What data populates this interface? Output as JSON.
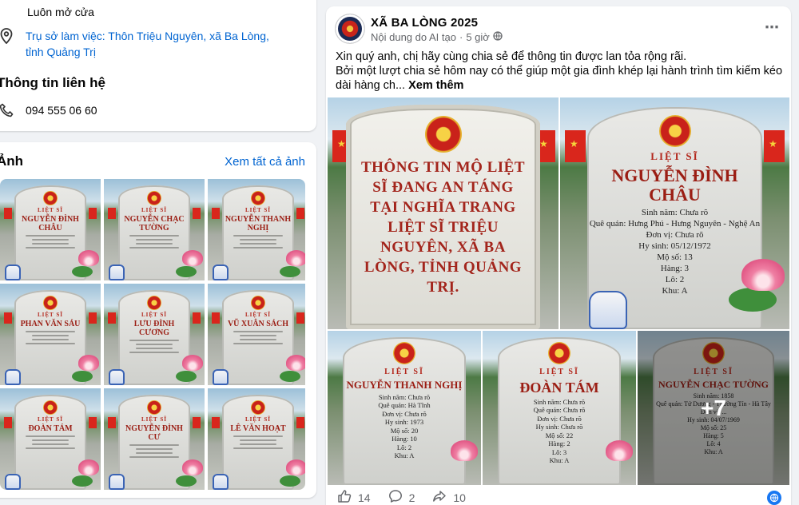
{
  "intro": {
    "hours": "Luôn mở cửa",
    "address": "Trụ sở làm việc: Thôn Triệu Nguyên, xã Ba Lòng, tỉnh Quảng Trị",
    "contact_title": "Thông tin liên hệ",
    "phone": "094 555 06 60"
  },
  "photos": {
    "title": "Ảnh",
    "see_all": "Xem tất cả ảnh",
    "tiles": [
      {
        "label": "LIỆT SĨ",
        "name": "NGUYỄN ĐÌNH CHÂU"
      },
      {
        "label": "LIỆT SĨ",
        "name": "NGUYỄN CHẠC TƯỜNG"
      },
      {
        "label": "LIỆT SĨ",
        "name": "NGUYỄN THANH NGHỊ"
      },
      {
        "label": "LIỆT SĨ",
        "name": "PHAN VĂN SÁU"
      },
      {
        "label": "LIỆT SĨ",
        "name": "LƯU ĐÌNH CƯƠNG"
      },
      {
        "label": "LIỆT SĨ",
        "name": "VŨ XUÂN SÁCH"
      },
      {
        "label": "LIỆT SĨ",
        "name": "ĐOÀN TÁM"
      },
      {
        "label": "LIỆT SĨ",
        "name": "NGUYỄN ĐÌNH CƯ"
      },
      {
        "label": "LIỆT SĨ",
        "name": "LÊ VĂN HOẠT"
      }
    ]
  },
  "post": {
    "page_name": "XÃ BA LÒNG 2025",
    "meta_label": "Nội dung do AI tạo",
    "meta_sep": "·",
    "meta_time": "5 giờ",
    "more_icon": "⋯",
    "text_line1": "Xin quý anh, chị hãy cùng chia sẻ để thông tin được lan tỏa rộng rãi.",
    "text_line2": "Bởi một lượt chia sẻ hôm nay có thể giúp một gia đình khép lại hành trình tìm kiếm kéo dài hàng ch...",
    "see_more": "Xem thêm",
    "main_image_title": "THÔNG TIN MỘ LIỆT SĨ ĐANG AN TÁNG TẠI NGHĨA TRANG LIỆT SĨ TRIỆU NGUYÊN, XÃ BA LÒNG, TỈNH QUẢNG TRỊ.",
    "grave_top_right": {
      "label": "LIỆT SĨ",
      "name": "NGUYỄN ĐÌNH CHÂU",
      "details": [
        "Sinh năm: Chưa rõ",
        "Quê quán: Hưng Phú - Hưng Nguyên - Nghệ An",
        "Đơn vị: Chưa rõ",
        "Hy sinh: 05/12/1972",
        "Mộ số: 13",
        "Hàng: 3",
        "Lô: 2",
        "Khu: A"
      ]
    },
    "grave_bottom": [
      {
        "label": "LIỆT SĨ",
        "name": "NGUYỄN THANH NGHỊ",
        "details": [
          "Sinh năm: Chưa rõ",
          "Quê quán: Hà Tĩnh",
          "Đơn vị: Chưa rõ",
          "Hy sinh: 1973",
          "Mộ số: 20",
          "Hàng: 10",
          "Lô: 2",
          "Khu: A"
        ]
      },
      {
        "label": "LIỆT SĨ",
        "name": "ĐOÀN TÁM",
        "details": [
          "Sinh năm: Chưa rõ",
          "Quê quán: Chưa rõ",
          "Đơn vị: Chưa rõ",
          "Hy sinh: Chưa rõ",
          "Mộ số: 22",
          "Hàng: 2",
          "Lô: 3",
          "Khu: A"
        ]
      },
      {
        "label": "LIỆT SĨ",
        "name": "NGUYỄN CHẠC TƯỜNG",
        "details": [
          "Sinh năm: 1858",
          "Quê quán: Tứ Dương - Thường Tín - Hà Tây",
          "Đơn vị: ...",
          "Hy sinh: 04/07/1969",
          "Mộ số: 25",
          "Hàng: 5",
          "Lô: 4",
          "Khu: A"
        ]
      }
    ],
    "more_count": "+7",
    "like_count": "14",
    "comment_count": "2",
    "share_count": "10"
  }
}
